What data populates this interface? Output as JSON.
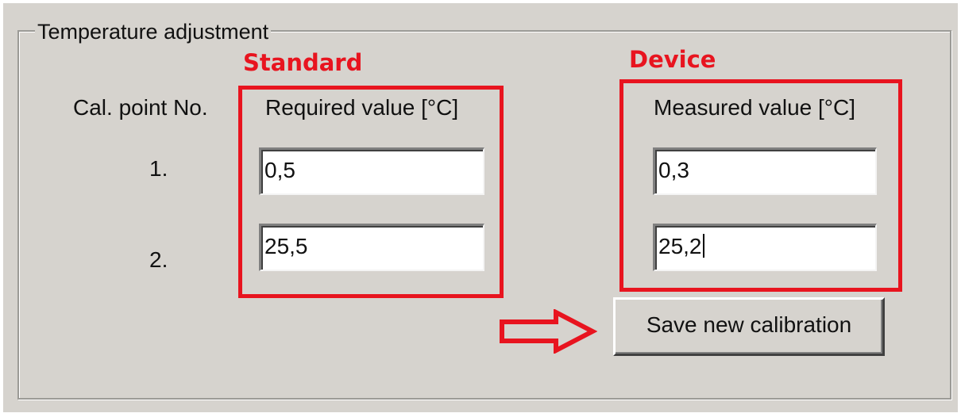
{
  "groupbox": {
    "title": "Temperature adjustment"
  },
  "annotations": {
    "standard": "Standard",
    "device": "Device",
    "color": "#e8141f",
    "arrow_icon": "right-arrow-icon"
  },
  "columns": {
    "cal_point": "Cal. point No.",
    "required": "Required value [°C]",
    "measured": "Measured value [°C]"
  },
  "rows": [
    {
      "number": "1.",
      "required": "0,5",
      "measured": "0,3"
    },
    {
      "number": "2.",
      "required": "25,5",
      "measured": "25,2"
    }
  ],
  "buttons": {
    "save": "Save new calibration"
  }
}
